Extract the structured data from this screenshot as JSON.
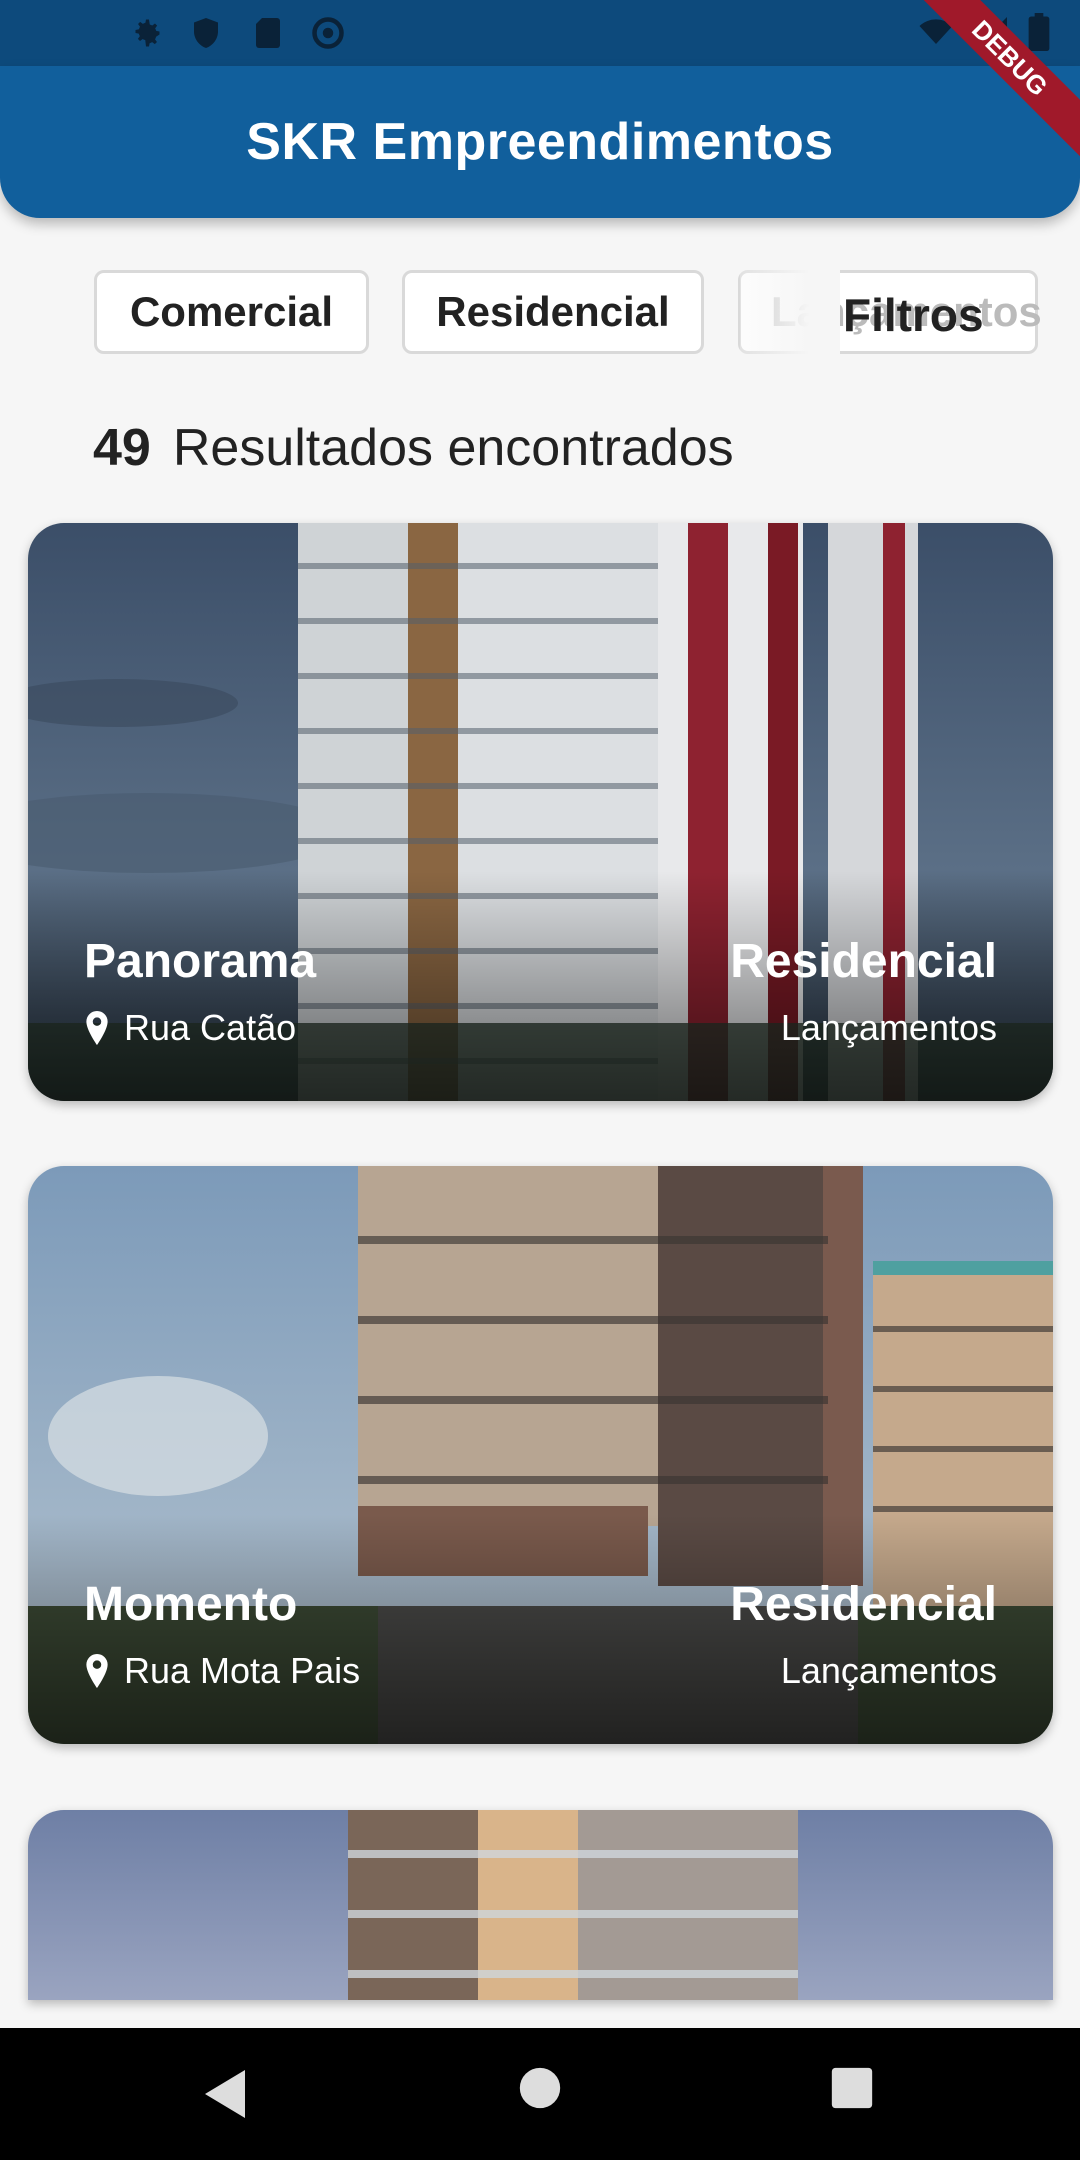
{
  "status_bar": {
    "left_icons": [
      "gear-icon",
      "shield-icon",
      "sd-card-icon",
      "at-sign-icon"
    ],
    "right_icons": [
      "wifi-icon",
      "signal-icon",
      "battery-icon"
    ]
  },
  "debug_banner": "DEBUG",
  "app_bar": {
    "title": "SKR Empreendimentos"
  },
  "filters": {
    "chips": [
      "Comercial",
      "Residencial",
      "Lançamentos"
    ],
    "label": "Filtros"
  },
  "results": {
    "count": "49",
    "label": "Resultados encontrados"
  },
  "listings": [
    {
      "name": "Panorama",
      "address": "Rua Catão",
      "type": "Residencial",
      "stage": "Lançamentos"
    },
    {
      "name": "Momento",
      "address": "Rua Mota Pais",
      "type": "Residencial",
      "stage": "Lançamentos"
    },
    {
      "name": "",
      "address": "",
      "type": "",
      "stage": ""
    }
  ],
  "nav_bar": {
    "buttons": [
      "back-icon",
      "home-icon",
      "recents-icon"
    ]
  }
}
